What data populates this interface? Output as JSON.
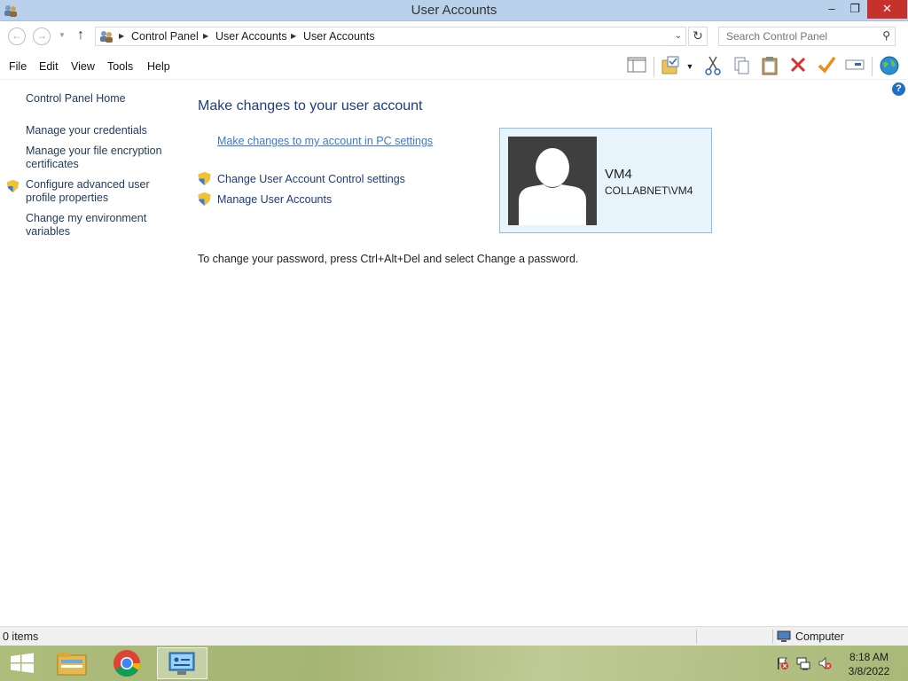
{
  "window": {
    "title": "User Accounts",
    "minimize": "–",
    "maximize": "❐",
    "close": "✕"
  },
  "nav": {
    "back_glyph": "←",
    "forward_glyph": "→",
    "up_glyph": "↑",
    "breadcrumbs": [
      "Control Panel",
      "User Accounts",
      "User Accounts"
    ],
    "refresh_glyph": "↻",
    "search_placeholder": "Search Control Panel"
  },
  "menu": {
    "items": [
      "File",
      "Edit",
      "View",
      "Tools",
      "Help"
    ],
    "toolbar_icons": [
      "layout-pane-icon",
      "folder-check-icon",
      "dropdown-icon",
      "cut-icon",
      "copy-icon",
      "paste-icon",
      "delete-icon",
      "checkmark-icon",
      "rename-icon",
      "globe-icon"
    ],
    "help_glyph": "?"
  },
  "sidebar": {
    "home": "Control Panel Home",
    "links": [
      "Manage your credentials",
      "Manage your file encryption certificates",
      "Configure advanced user profile properties",
      "Change my environment variables"
    ]
  },
  "main": {
    "heading": "Make changes to your user account",
    "pc_settings_link": "Make changes to my account in PC settings",
    "tasks": [
      "Change User Account Control settings",
      "Manage User Accounts"
    ],
    "password_note": "To change your password, press Ctrl+Alt+Del and select Change a password."
  },
  "account": {
    "name": "VM4",
    "domain": "COLLABNET\\VM4"
  },
  "status": {
    "items": "0 items",
    "location": "Computer"
  },
  "taskbar": {
    "pinned": [
      "start-button",
      "file-explorer",
      "chrome",
      "control-panel"
    ],
    "time": "8:18 AM",
    "date": "3/8/2022"
  },
  "colors": {
    "titlebar": "#b9d1ea",
    "link": "#1e3c7b",
    "close_button": "#c7312b",
    "card_bg": "#e8f4fb"
  }
}
